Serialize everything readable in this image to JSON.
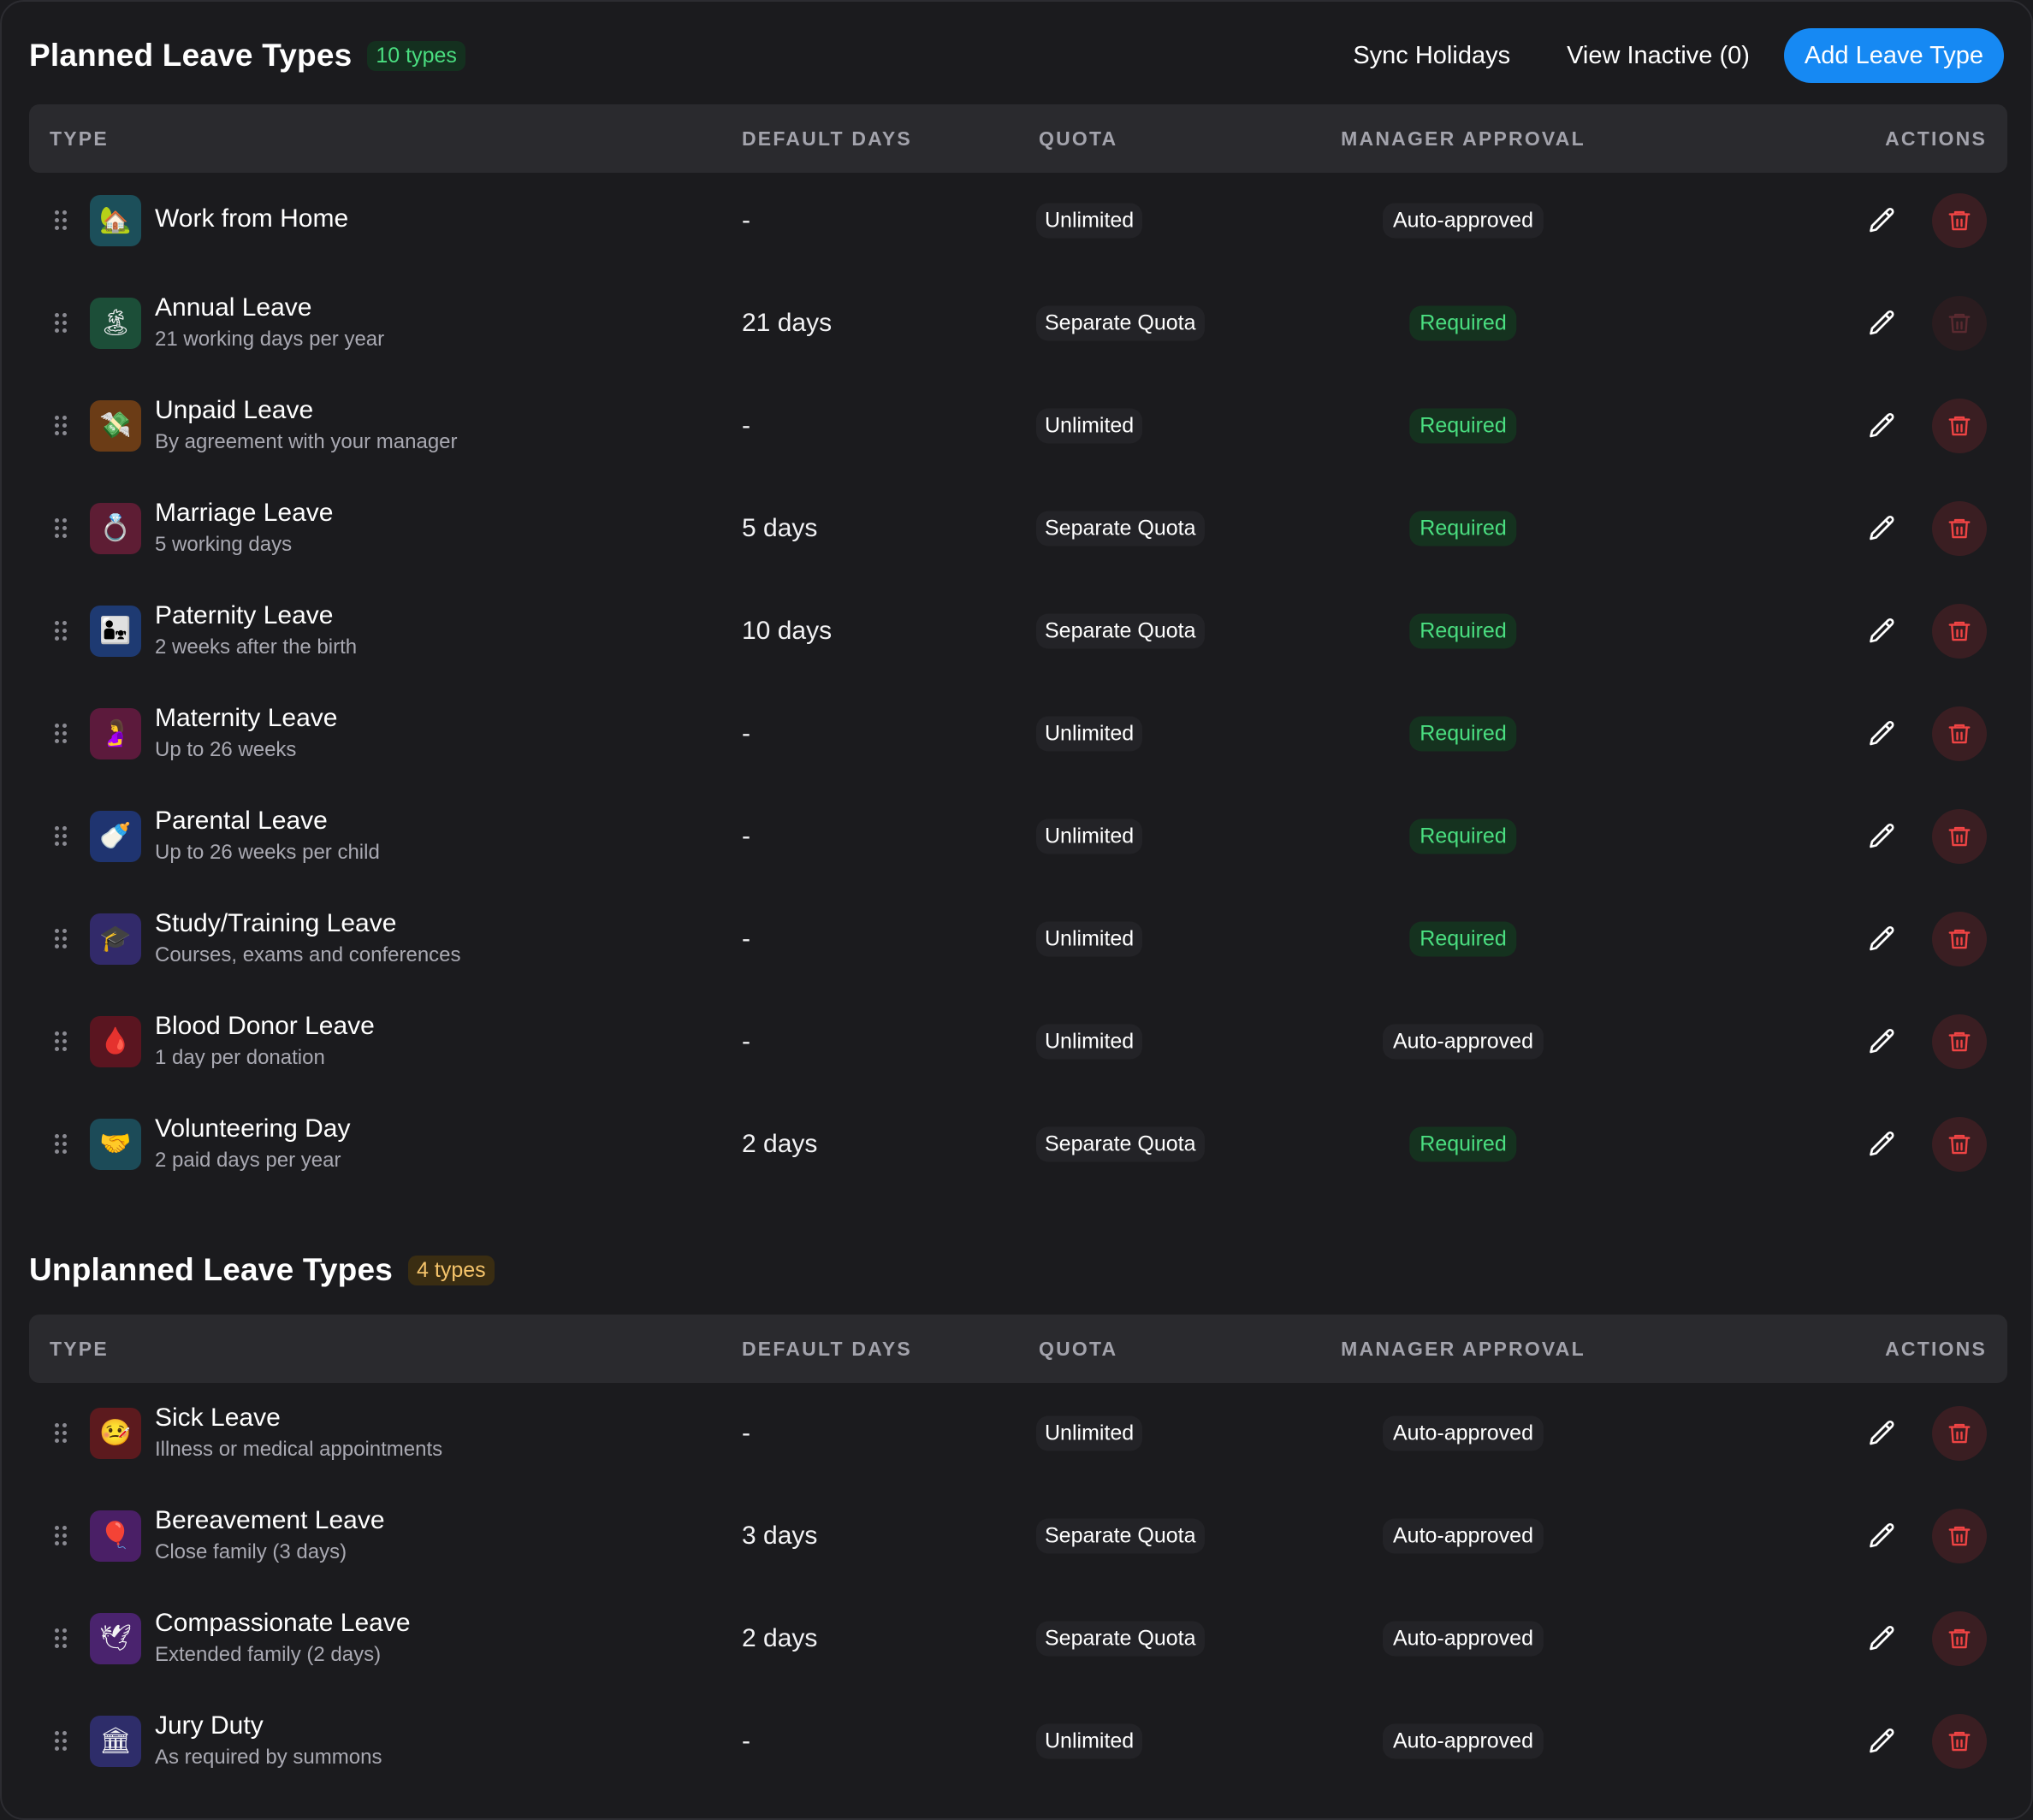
{
  "planned": {
    "title": "Planned Leave Types",
    "count": "10 types",
    "actions": {
      "sync": "Sync Holidays",
      "view_inactive": "View Inactive (0)",
      "add": "Add Leave Type"
    },
    "columns": {
      "type": "TYPE",
      "default_days": "DEFAULT DAYS",
      "quota": "QUOTA",
      "approval": "MANAGER APPROVAL",
      "actions": "ACTIONS"
    },
    "rows": [
      {
        "icon": "house-icon",
        "emoji": "🏡",
        "tile": "#1c4f5a",
        "name": "Work from Home",
        "desc": "",
        "days": "-",
        "quota": "Unlimited",
        "approval": "Auto-approved",
        "approval_kind": "auto",
        "delete_enabled": true
      },
      {
        "icon": "island-icon",
        "emoji": "🏝",
        "tile": "#1c4e38",
        "name": "Annual Leave",
        "desc": "21 working days per year",
        "days": "21 days",
        "quota": "Separate Quota",
        "approval": "Required",
        "approval_kind": "req",
        "delete_enabled": false
      },
      {
        "icon": "money-icon",
        "emoji": "💸",
        "tile": "#6b3c16",
        "name": "Unpaid Leave",
        "desc": "By agreement with your manager",
        "days": "-",
        "quota": "Unlimited",
        "approval": "Required",
        "approval_kind": "req",
        "delete_enabled": true
      },
      {
        "icon": "ring-icon",
        "emoji": "💍",
        "tile": "#5e1d34",
        "name": "Marriage Leave",
        "desc": "5 working days",
        "days": "5 days",
        "quota": "Separate Quota",
        "approval": "Required",
        "approval_kind": "req",
        "delete_enabled": true
      },
      {
        "icon": "family-icon",
        "emoji": "👨‍👧",
        "tile": "#1e3a72",
        "name": "Paternity Leave",
        "desc": "2 weeks after the birth",
        "days": "10 days",
        "quota": "Separate Quota",
        "approval": "Required",
        "approval_kind": "req",
        "delete_enabled": true
      },
      {
        "icon": "pregnant-icon",
        "emoji": "🤰",
        "tile": "#5c1a3c",
        "name": "Maternity Leave",
        "desc": "Up to 26 weeks",
        "days": "-",
        "quota": "Unlimited",
        "approval": "Required",
        "approval_kind": "req",
        "delete_enabled": true
      },
      {
        "icon": "baby-bottle-icon",
        "emoji": "🍼",
        "tile": "#1f3470",
        "name": "Parental Leave",
        "desc": "Up to 26 weeks per child",
        "days": "-",
        "quota": "Unlimited",
        "approval": "Required",
        "approval_kind": "req",
        "delete_enabled": true
      },
      {
        "icon": "graduation-cap-icon",
        "emoji": "🎓",
        "tile": "#322a6a",
        "name": "Study/Training Leave",
        "desc": "Courses, exams and conferences",
        "days": "-",
        "quota": "Unlimited",
        "approval": "Required",
        "approval_kind": "req",
        "delete_enabled": true
      },
      {
        "icon": "blood-drop-icon",
        "emoji": "🩸",
        "tile": "#5a1520",
        "name": "Blood Donor Leave",
        "desc": "1 day per donation",
        "days": "-",
        "quota": "Unlimited",
        "approval": "Auto-approved",
        "approval_kind": "auto",
        "delete_enabled": true
      },
      {
        "icon": "handshake-icon",
        "emoji": "🤝",
        "tile": "#1c4b58",
        "name": "Volunteering Day",
        "desc": "2 paid days per year",
        "days": "2 days",
        "quota": "Separate Quota",
        "approval": "Required",
        "approval_kind": "req",
        "delete_enabled": true
      }
    ]
  },
  "unplanned": {
    "title": "Unplanned Leave Types",
    "count": "4 types",
    "columns": {
      "type": "TYPE",
      "default_days": "DEFAULT DAYS",
      "quota": "QUOTA",
      "approval": "MANAGER APPROVAL",
      "actions": "ACTIONS"
    },
    "rows": [
      {
        "icon": "sick-face-icon",
        "emoji": "🤒",
        "tile": "#5c1a1e",
        "name": "Sick Leave",
        "desc": "Illness or medical appointments",
        "days": "-",
        "quota": "Unlimited",
        "approval": "Auto-approved",
        "approval_kind": "auto",
        "delete_enabled": true
      },
      {
        "icon": "balloon-icon",
        "emoji": "🎈",
        "tile": "#4a1f66",
        "name": "Bereavement Leave",
        "desc": "Close family (3 days)",
        "days": "3 days",
        "quota": "Separate Quota",
        "approval": "Auto-approved",
        "approval_kind": "auto",
        "delete_enabled": true
      },
      {
        "icon": "dove-icon",
        "emoji": "🕊",
        "tile": "#4a236e",
        "name": "Compassionate Leave",
        "desc": "Extended family (2 days)",
        "days": "2 days",
        "quota": "Separate Quota",
        "approval": "Auto-approved",
        "approval_kind": "auto",
        "delete_enabled": true
      },
      {
        "icon": "courthouse-icon",
        "emoji": "🏛",
        "tile": "#2e2d6a",
        "name": "Jury Duty",
        "desc": "As required by summons",
        "days": "-",
        "quota": "Unlimited",
        "approval": "Auto-approved",
        "approval_kind": "auto",
        "delete_enabled": true
      }
    ]
  }
}
